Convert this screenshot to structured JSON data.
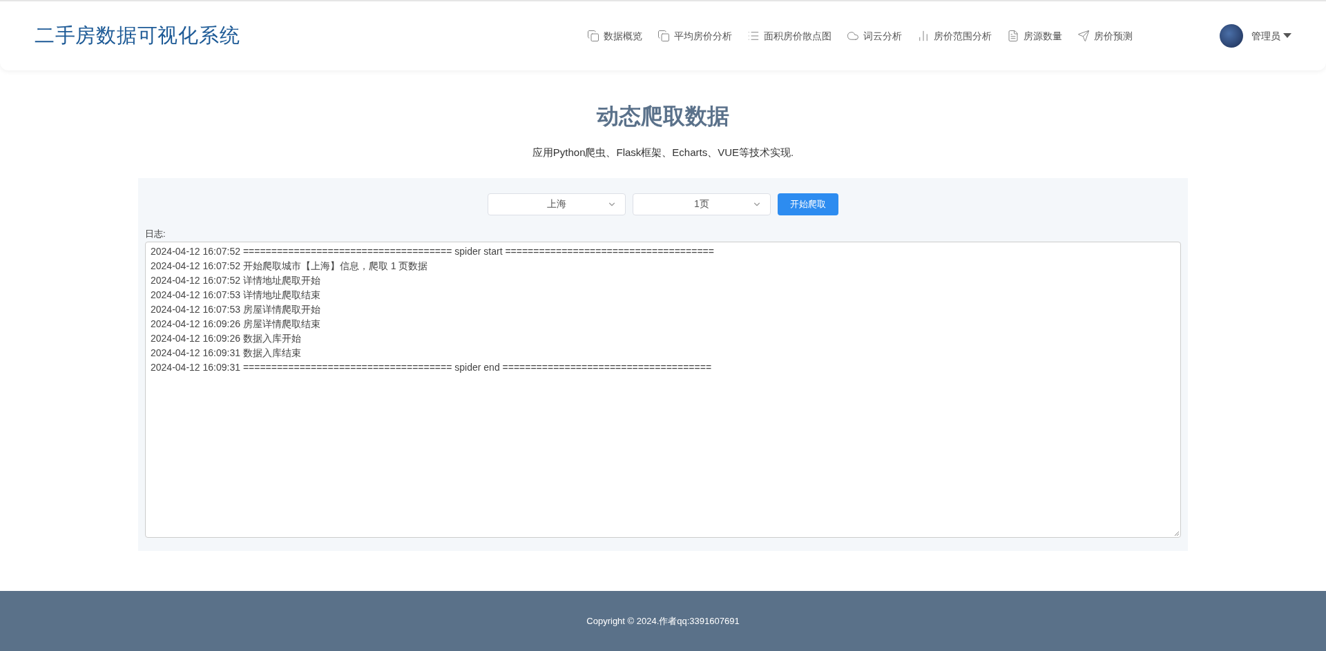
{
  "header": {
    "title": "二手房数据可视化系统",
    "nav": [
      {
        "label": "数据概览"
      },
      {
        "label": "平均房价分析"
      },
      {
        "label": "面积房价散点图"
      },
      {
        "label": "词云分析"
      },
      {
        "label": "房价范围分析"
      },
      {
        "label": "房源数量"
      },
      {
        "label": "房价预测"
      }
    ],
    "user": {
      "name": "管理员"
    }
  },
  "hero": {
    "title": "动态爬取数据",
    "subtitle": "应用Python爬虫、Flask框架、Echarts、VUE等技术实现."
  },
  "form": {
    "city": "上海",
    "pages": "1页",
    "button": "开始爬取"
  },
  "log": {
    "label": "日志:",
    "lines": [
      "2024-04-12 16:07:52 ===================================== spider start =====================================",
      "2024-04-12 16:07:52 开始爬取城市【上海】信息，爬取 1 页数据",
      "2024-04-12 16:07:52 详情地址爬取开始",
      "2024-04-12 16:07:53 详情地址爬取结束",
      "2024-04-12 16:07:53 房屋详情爬取开始",
      "2024-04-12 16:09:26 房屋详情爬取结束",
      "2024-04-12 16:09:26 数据入库开始",
      "2024-04-12 16:09:31 数据入库结束",
      "2024-04-12 16:09:31 ===================================== spider end ====================================="
    ]
  },
  "footer": {
    "copyright": "Copyright © 2024.作者qq:3391607691"
  }
}
